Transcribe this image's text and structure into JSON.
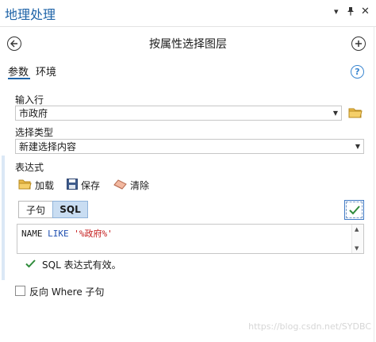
{
  "pane": {
    "title": "地理处理",
    "header_icons": [
      "chevron-down-icon",
      "pin-icon",
      "close-icon"
    ]
  },
  "tool": {
    "title": "按属性选择图层",
    "back_icon": "back-arrow-icon",
    "add_icon": "add-icon"
  },
  "tabs": [
    {
      "label": "参数",
      "active": true
    },
    {
      "label": "环境",
      "active": false
    }
  ],
  "help_label": "?",
  "input_rows": {
    "label": "输入行",
    "value": "市政府"
  },
  "selection_type": {
    "label": "选择类型",
    "value": "新建选择内容"
  },
  "expression": {
    "label": "表达式",
    "toolbar": [
      {
        "label": "加载",
        "icon": "folder-open-icon"
      },
      {
        "label": "保存",
        "icon": "save-icon"
      },
      {
        "label": "清除",
        "icon": "eraser-icon"
      }
    ],
    "modes": [
      {
        "label": "子句",
        "active": false
      },
      {
        "label": "SQL",
        "active": true
      }
    ],
    "sql": {
      "field": "NAME",
      "operator": "LIKE",
      "value": "'%政府%'"
    },
    "validation_message": "SQL 表达式有效。"
  },
  "invert_where": {
    "label": "反向 Where 子句",
    "checked": false
  },
  "watermark": "https://blog.csdn.net/SYDBC",
  "colors": {
    "accent": "#1f64a8",
    "valid_green": "#2e8b3a",
    "sql_keyword": "#1f4fb0",
    "sql_string": "#c41a1a"
  }
}
